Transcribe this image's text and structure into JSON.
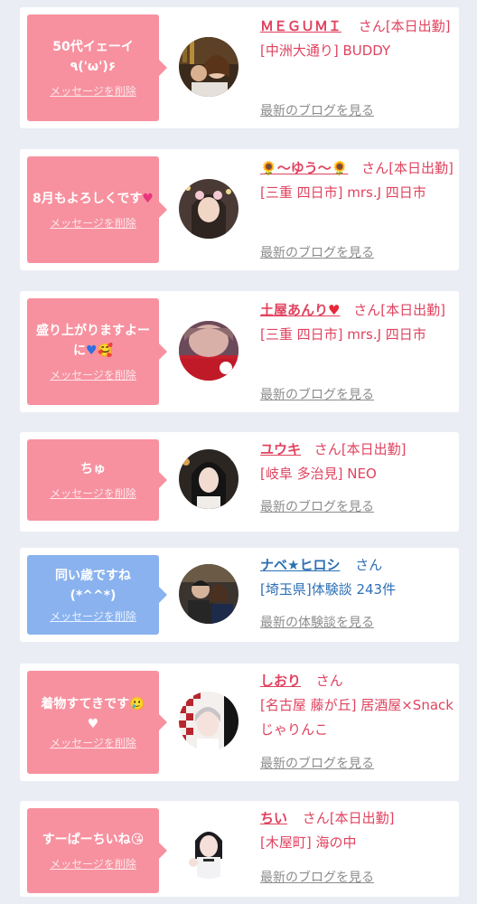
{
  "delete_label": "メッセージを削除",
  "colors": {
    "pink": "#f7919f",
    "blue": "#89b2ef",
    "name_pink": "#e0435f",
    "name_blue": "#2d6fb5"
  },
  "items": [
    {
      "message": "50代イェーイ٩('ω')۶",
      "name": "ＭＥＧＵＭＩ",
      "san": "さん",
      "status": "[本日出勤]",
      "location": "[中洲大通り] BUDDY",
      "link": "最新のブログを見る"
    },
    {
      "message": "8月もよろしくです",
      "message_emoji": "pink-heart-icon",
      "name": "〜ゆう〜",
      "name_emoji": "sunflower-icon",
      "san": "さん",
      "status": "[本日出勤]",
      "location": "[三重 四日市] mrs.J 四日市",
      "link": "最新のブログを見る"
    },
    {
      "message": "盛り上がりますよーに",
      "message_emoji": "blue-heart-icon smiling-face-with-hearts-icon",
      "name": "土屋あんり",
      "name_emoji": "red-heart-icon",
      "san": "さん",
      "status": "[本日出勤]",
      "location": "[三重 四日市] mrs.J 四日市",
      "link": "最新のブログを見る"
    },
    {
      "message": "ちゅ",
      "name": "ユウキ",
      "san": "さん",
      "status": "[本日出勤]",
      "location": "[岐阜 多治見] NEO",
      "link": "最新のブログを見る"
    },
    {
      "message": "同い歳ですね(*^^*)",
      "name": "ナベ★ヒロシ",
      "san": "さん",
      "location": "[埼玉県]体験談 243件",
      "link": "最新の体験談を見る"
    },
    {
      "message": "着物すてきです",
      "message_emoji": "face-holding-back-tears-icon white-heart-icon",
      "name": "しおり",
      "san": "さん",
      "location": "[名古屋 藤が丘] 居酒屋×Snack じゃりんこ",
      "link": "最新のブログを見る"
    },
    {
      "message": "すーぱーちいね",
      "message_emoji": "face-blowing-kiss-icon",
      "name": "ちい",
      "san": "さん",
      "status": "[本日出勤]",
      "location": "[木屋町] 海の中",
      "link": "最新のブログを見る"
    }
  ]
}
